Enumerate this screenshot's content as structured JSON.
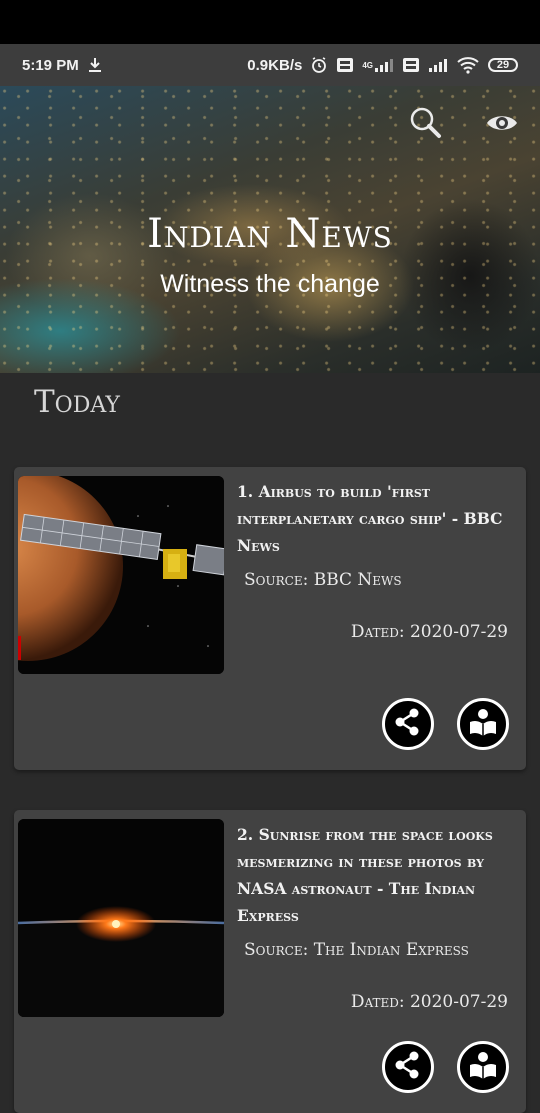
{
  "status_bar": {
    "time": "5:19 PM",
    "speed": "0.9KB/s",
    "network_label": "4G",
    "battery": "29"
  },
  "header": {
    "title": "Indian News",
    "subtitle": "Witness the change"
  },
  "section": {
    "title": "Today"
  },
  "articles": [
    {
      "title": "1. Airbus to build 'first interplanetary cargo ship' - BBC News",
      "source": "Source: BBC News",
      "date": "Dated: 2020-07-29"
    },
    {
      "title": "2. Sunrise from the space looks mesmerizing in these photos by NASA astronaut - The Indian Express",
      "source": "Source: The Indian Express",
      "date": "Dated: 2020-07-29"
    }
  ],
  "colors": {
    "background": "#2a2a2a",
    "card": "#424242",
    "statusbar": "#3d3d3d"
  }
}
